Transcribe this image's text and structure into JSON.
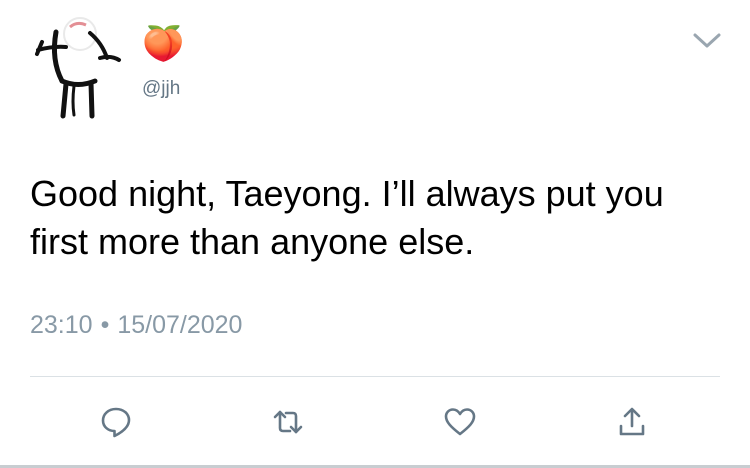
{
  "tweet": {
    "display_name": "🍑",
    "handle": "@jjh",
    "text": "Good night, Taeyong. I’ll always put you first more than anyone else.",
    "time": "23:10",
    "separator": "•",
    "date": "15/07/2020"
  },
  "icons": {
    "avatar": "stick-figure-cartoon-avatar",
    "more": "chevron-down-icon",
    "reply": "reply-bubble-icon",
    "retweet": "retweet-arrows-icon",
    "like": "heart-outline-icon",
    "share": "share-upload-icon"
  },
  "colors": {
    "text": "#000000",
    "secondary": "#657786",
    "icon": "#657786",
    "divider": "#dbe1e5"
  }
}
